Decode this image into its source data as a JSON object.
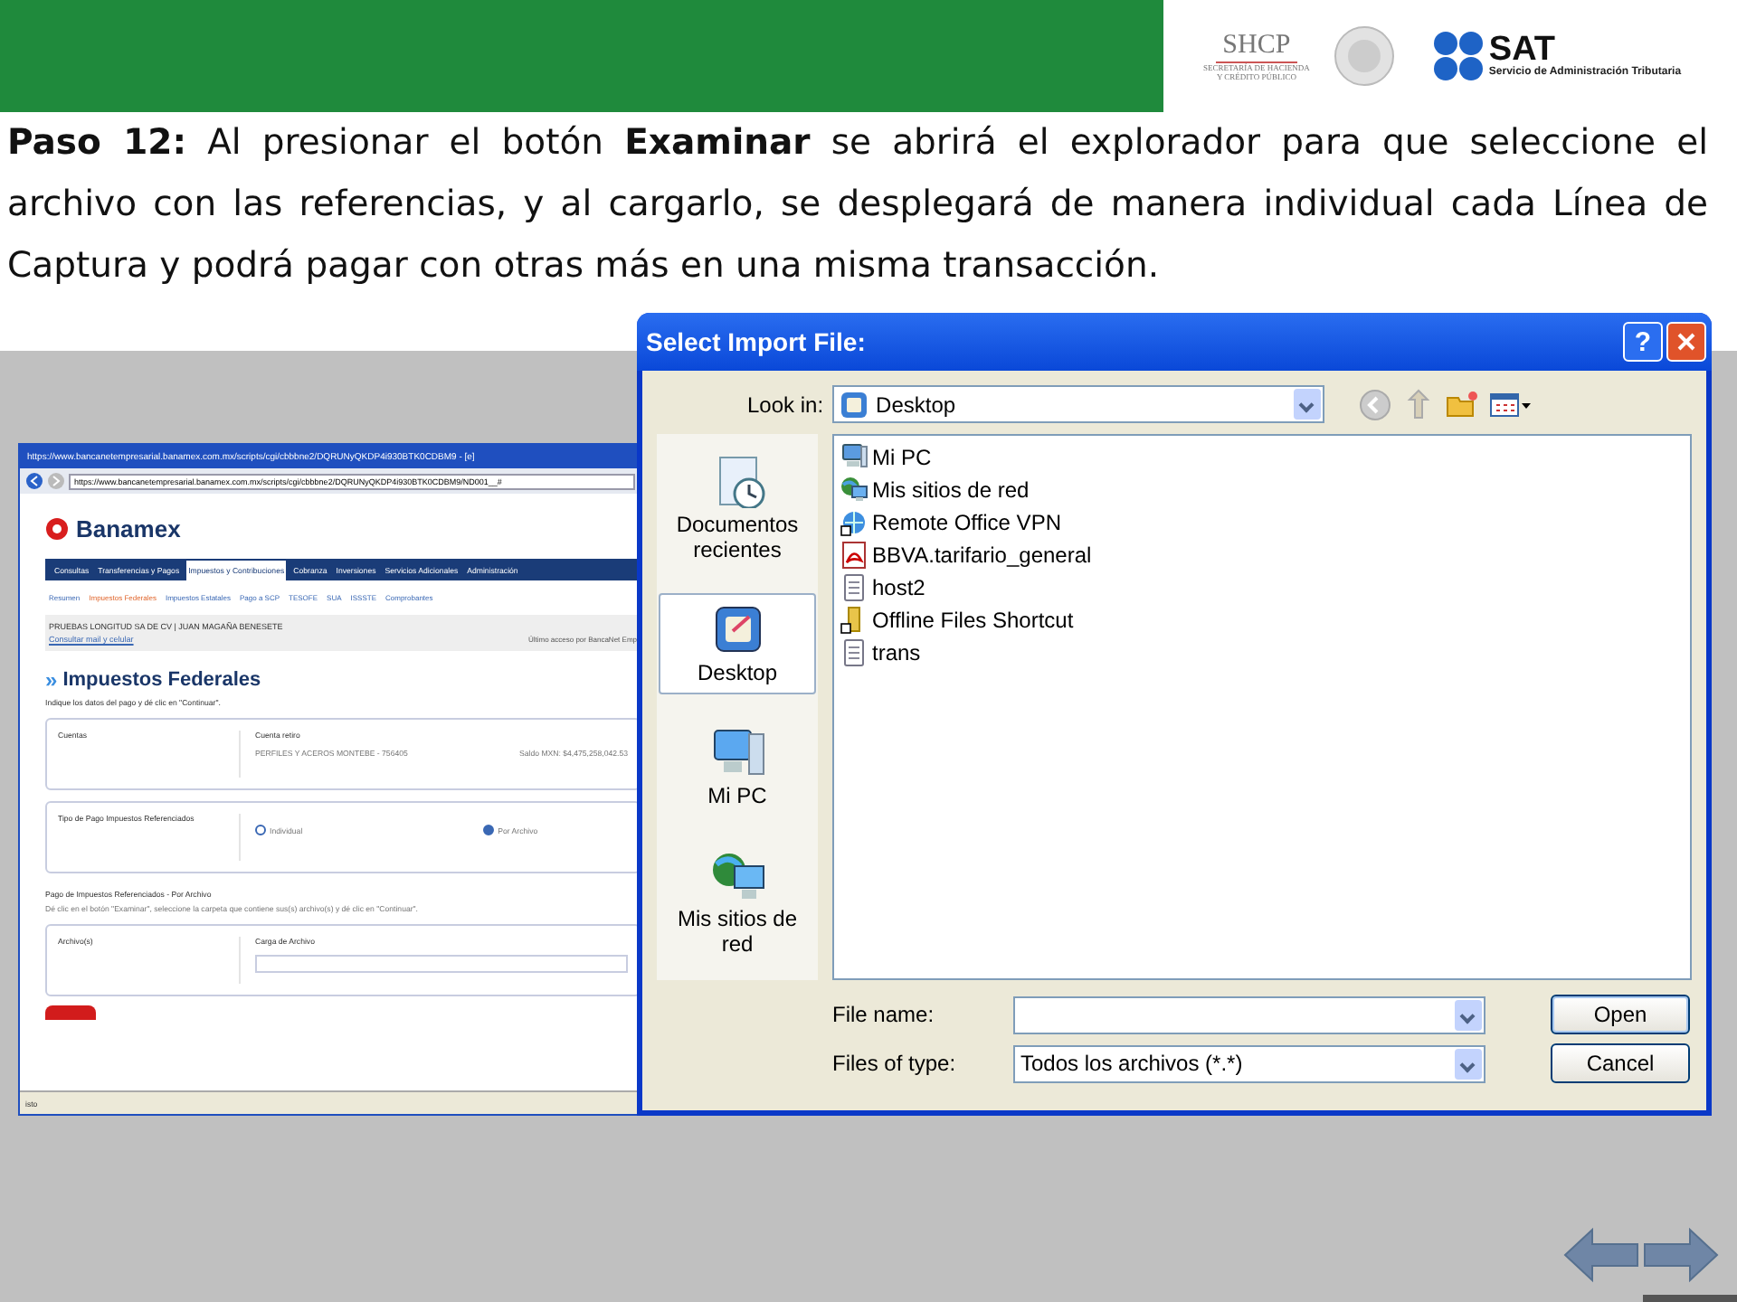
{
  "header": {
    "shcp": {
      "acronym": "SHCP",
      "line_1": "SECRETARÍA DE HACIENDA",
      "line_2": "Y CRÉDITO PÚBLICO"
    },
    "sat": {
      "acronym": "SAT",
      "subtitle": "Servicio de Administración Tributaria"
    }
  },
  "instruction": "**Paso 12:** Al presionar el botón **Examinar** se abrirá el explorador para que seleccione el archivo con las referencias, y al cargarlo, se desplegará de manera individual cada Línea de Captura y podrá pagar con otras más en una misma transacción.",
  "browser": {
    "title_url": "https://www.bancanetempresarial.banamex.com.mx/scripts/cgi/cbbbne2/DQRUNyQKDP4i930BTK0CDBM9 - [e]",
    "address_url": "https://www.bancanetempresarial.banamex.com.mx/scripts/cgi/cbbbne2/DQRUNyQKDP4i930BTK0CDBM9/ND001__#",
    "brand": "Banamex",
    "nav_tabs": [
      {
        "label": "Consultas",
        "selected": false
      },
      {
        "label": "Transferencias y Pagos",
        "selected": false
      },
      {
        "label": "Impuestos y Contribuciones",
        "selected": true
      },
      {
        "label": "Cobranza",
        "selected": false
      },
      {
        "label": "Inversiones",
        "selected": false
      },
      {
        "label": "Servicios Adicionales",
        "selected": false
      },
      {
        "label": "Administración",
        "selected": false
      }
    ],
    "sub_tabs": [
      {
        "label": "Resumen",
        "selected": false
      },
      {
        "label": "Impuestos Federales",
        "selected": true
      },
      {
        "label": "Impuestos Estatales",
        "selected": false
      },
      {
        "label": "Pago a SCP",
        "selected": false
      },
      {
        "label": "TESOFE",
        "selected": false
      },
      {
        "label": "SUA",
        "selected": false
      },
      {
        "label": "ISSSTE",
        "selected": false
      },
      {
        "label": "Comprobantes",
        "selected": false
      }
    ],
    "company": "PRUEBAS LONGITUD SA DE CV | JUAN MAGAÑA BENESETE",
    "company_link": "Consultar mail y celular",
    "last_access": "Último acceso por BancaNet Emp",
    "heading_mark": "»",
    "heading": "Impuestos Federales",
    "heading_hint": "Indique los datos del pago y dé clic en \"Continuar\".",
    "accounts": {
      "label": "Cuentas",
      "field_label": "Cuenta retiro",
      "account": "PERFILES Y ACEROS MONTEBE - 756405",
      "balance": "Saldo MXN: $4,475,258,042.53"
    },
    "payment_type": {
      "label": "Tipo de Pago Impuestos Referenciados",
      "options": [
        {
          "label": "Individual",
          "selected": false
        },
        {
          "label": "Por Archivo",
          "selected": true
        }
      ]
    },
    "file_section": {
      "title": "Pago de Impuestos Referenciados - Por Archivo",
      "hint": "Dé clic en el botón \"Examinar\", seleccione la carpeta que contiene sus(s) archivo(s) y dé clic en \"Continuar\".",
      "label": "Archivo(s)",
      "field_label": "Carga de Archivo"
    },
    "status": "isto"
  },
  "dialog": {
    "title": "Select Import File:",
    "help_button": "?",
    "look_in_label": "Look in:",
    "look_in_value": "Desktop",
    "places": [
      {
        "label": "Documentos recientes",
        "kind": "recent",
        "selected": false
      },
      {
        "label": "Desktop",
        "kind": "desktop",
        "selected": true
      },
      {
        "label": "Mi PC",
        "kind": "computer",
        "selected": false
      },
      {
        "label": "Mis sitios de red",
        "kind": "network",
        "selected": false
      }
    ],
    "files": [
      {
        "name": "Mi PC",
        "kind": "computer"
      },
      {
        "name": "Mis sitios de red",
        "kind": "network"
      },
      {
        "name": "Remote Office VPN",
        "kind": "globe"
      },
      {
        "name": "BBVA.tarifario_general",
        "kind": "pdf"
      },
      {
        "name": "host2",
        "kind": "text"
      },
      {
        "name": "Offline Files Shortcut",
        "kind": "shortcut"
      },
      {
        "name": "trans",
        "kind": "text"
      }
    ],
    "file_name_label": "File name:",
    "files_of_type_label": "Files of type:",
    "files_of_type_value": "Todos los archivos (*.*)",
    "open_button": "Open",
    "cancel_button": "Cancel"
  }
}
